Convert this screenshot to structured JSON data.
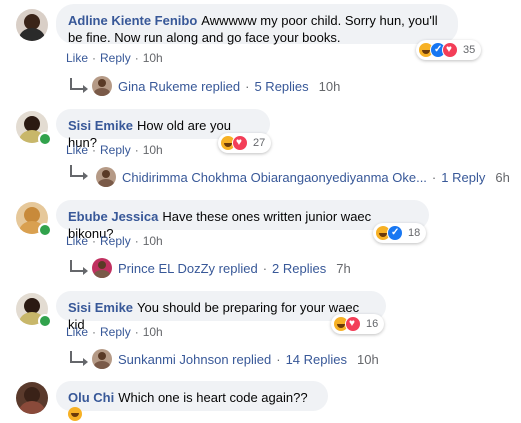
{
  "comments": [
    {
      "author": "Adline Kiente Fenibo",
      "text": "Awwwww my poor child. Sorry hun, you'll be fine. Now run along and go face your books.",
      "like": "Like",
      "reply": "Reply",
      "time": "10h",
      "reactions": [
        "haha",
        "like",
        "love"
      ],
      "reaction_count": "35",
      "replies": {
        "name": "Gina Rukeme replied",
        "count": "5 Replies",
        "time": "10h"
      }
    },
    {
      "author": "Sisi Emike",
      "text": "How old are you hun?",
      "like": "Like",
      "reply": "Reply",
      "time": "10h",
      "reactions": [
        "haha",
        "love"
      ],
      "reaction_count": "27",
      "replies": {
        "name": "Chidirimma Chokhma Obiarangaonyediyanma Oke...",
        "count": "1 Reply",
        "time": "6h"
      }
    },
    {
      "author": "Ebube Jessica",
      "text": "Have these ones written junior waec bikonu?",
      "like": "Like",
      "reply": "Reply",
      "time": "10h",
      "reactions": [
        "haha",
        "like"
      ],
      "reaction_count": "18",
      "replies": {
        "name": "Prince EL DozZy replied",
        "count": "2 Replies",
        "time": "7h"
      }
    },
    {
      "author": "Sisi Emike",
      "text": "You should be preparing for your waec kid",
      "like": "Like",
      "reply": "Reply",
      "time": "10h",
      "reactions": [
        "haha",
        "love"
      ],
      "reaction_count": "16",
      "replies": {
        "name": "Sunkanmi Johnson replied",
        "count": "14 Replies",
        "time": "10h"
      }
    },
    {
      "author": "Olu Chi",
      "text": "Which one is heart code again??",
      "emoji": "laughing-emoji"
    }
  ],
  "colors": {
    "link": "#385898",
    "muted": "#65676b",
    "bubble": "#f0f2f5",
    "online": "#31a24c"
  }
}
